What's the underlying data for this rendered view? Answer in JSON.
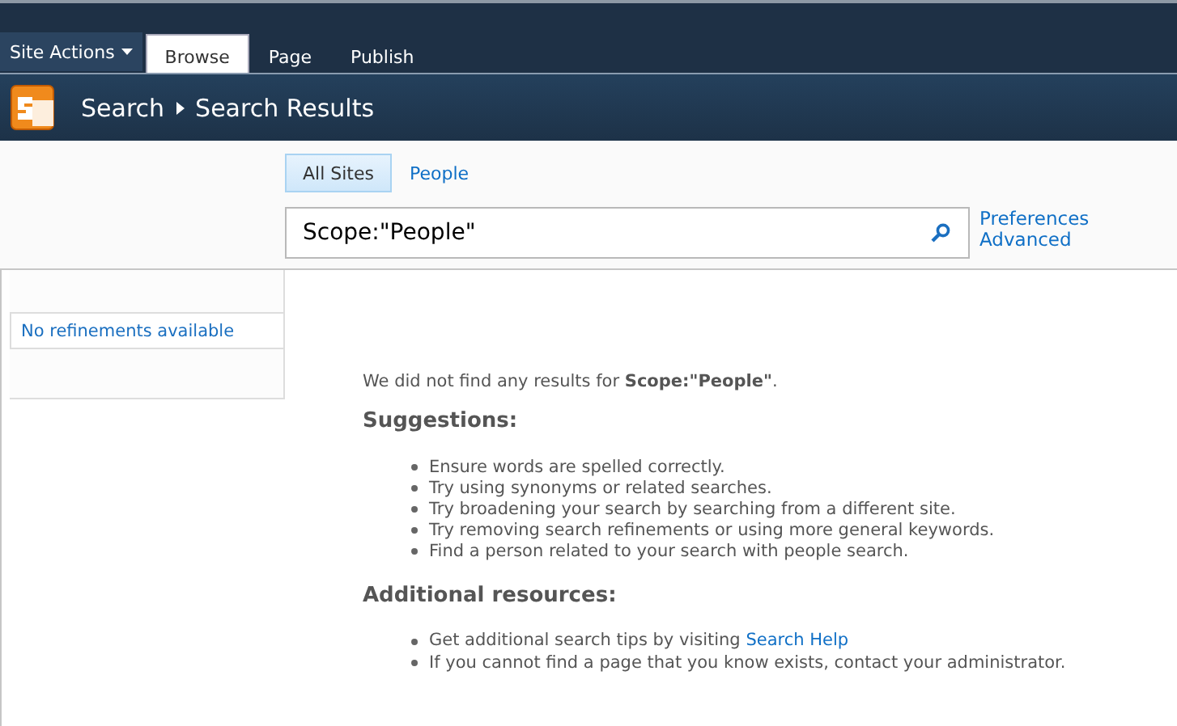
{
  "ribbon": {
    "site_actions": "Site Actions",
    "tabs": [
      {
        "label": "Browse",
        "selected": true
      },
      {
        "label": "Page",
        "selected": false
      },
      {
        "label": "Publish",
        "selected": false
      }
    ]
  },
  "breadcrumb": {
    "items": [
      "Search",
      "Search Results"
    ]
  },
  "scopes": [
    {
      "label": "All Sites",
      "selected": true
    },
    {
      "label": "People",
      "selected": false
    }
  ],
  "search": {
    "value": "Scope:\"People\""
  },
  "search_links": [
    "Preferences",
    "Advanced"
  ],
  "refinements": {
    "message": "No refinements available"
  },
  "results": {
    "message": "We did not find any results for **Scope:\"People\"**.",
    "suggestions_heading": "Suggestions:",
    "suggestions": [
      "Ensure words are spelled correctly.",
      "Try using synonyms or related searches.",
      "Try broadening your search by searching from a different site.",
      "Try removing search refinements or using more general keywords.",
      "Find a person related to your search with people search."
    ],
    "resources_heading": "Additional resources:",
    "resources": [
      {
        "text": "Get additional search tips by visiting ",
        "link": "Search Help"
      },
      {
        "text": "If you cannot find a page that you know exists, contact your administrator."
      }
    ]
  }
}
